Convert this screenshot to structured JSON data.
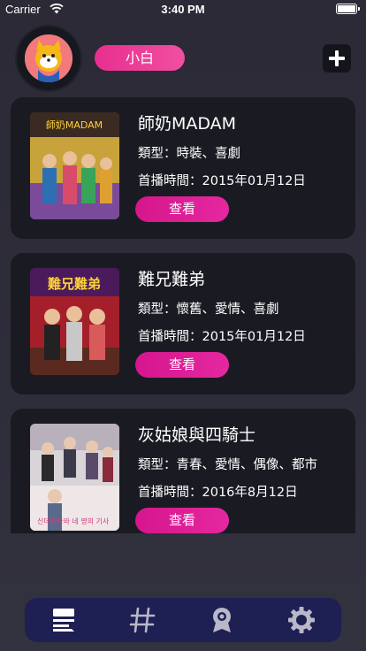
{
  "status_bar": {
    "carrier": "Carrier",
    "time": "3:40 PM"
  },
  "profile": {
    "name": "小白"
  },
  "dramas": [
    {
      "title": "師奶MADAM",
      "genre": "類型：時裝、喜劇",
      "premiere": "首播時間：2015年01月12日",
      "button": "查看",
      "poster_text": "師奶MADAM"
    },
    {
      "title": "難兄難弟",
      "genre": "類型：懷舊、愛情、喜劇",
      "premiere": "首播時間：2015年01月12日",
      "button": "查看",
      "poster_text": "難兄難弟"
    },
    {
      "title": "灰姑娘與四騎士",
      "genre": "類型：青春、愛情、偶像、都市",
      "premiere": "首播時間：2016年8月12日",
      "button": "查看",
      "poster_text": "신데렐라와 네 명의 기사"
    }
  ],
  "tabbar": {
    "tabs": [
      "list-icon",
      "hash-icon",
      "award-icon",
      "gear-icon"
    ]
  },
  "colors": {
    "accent": "#e528a0",
    "card": "#1a1b22",
    "tabbar": "#1e1f52"
  }
}
